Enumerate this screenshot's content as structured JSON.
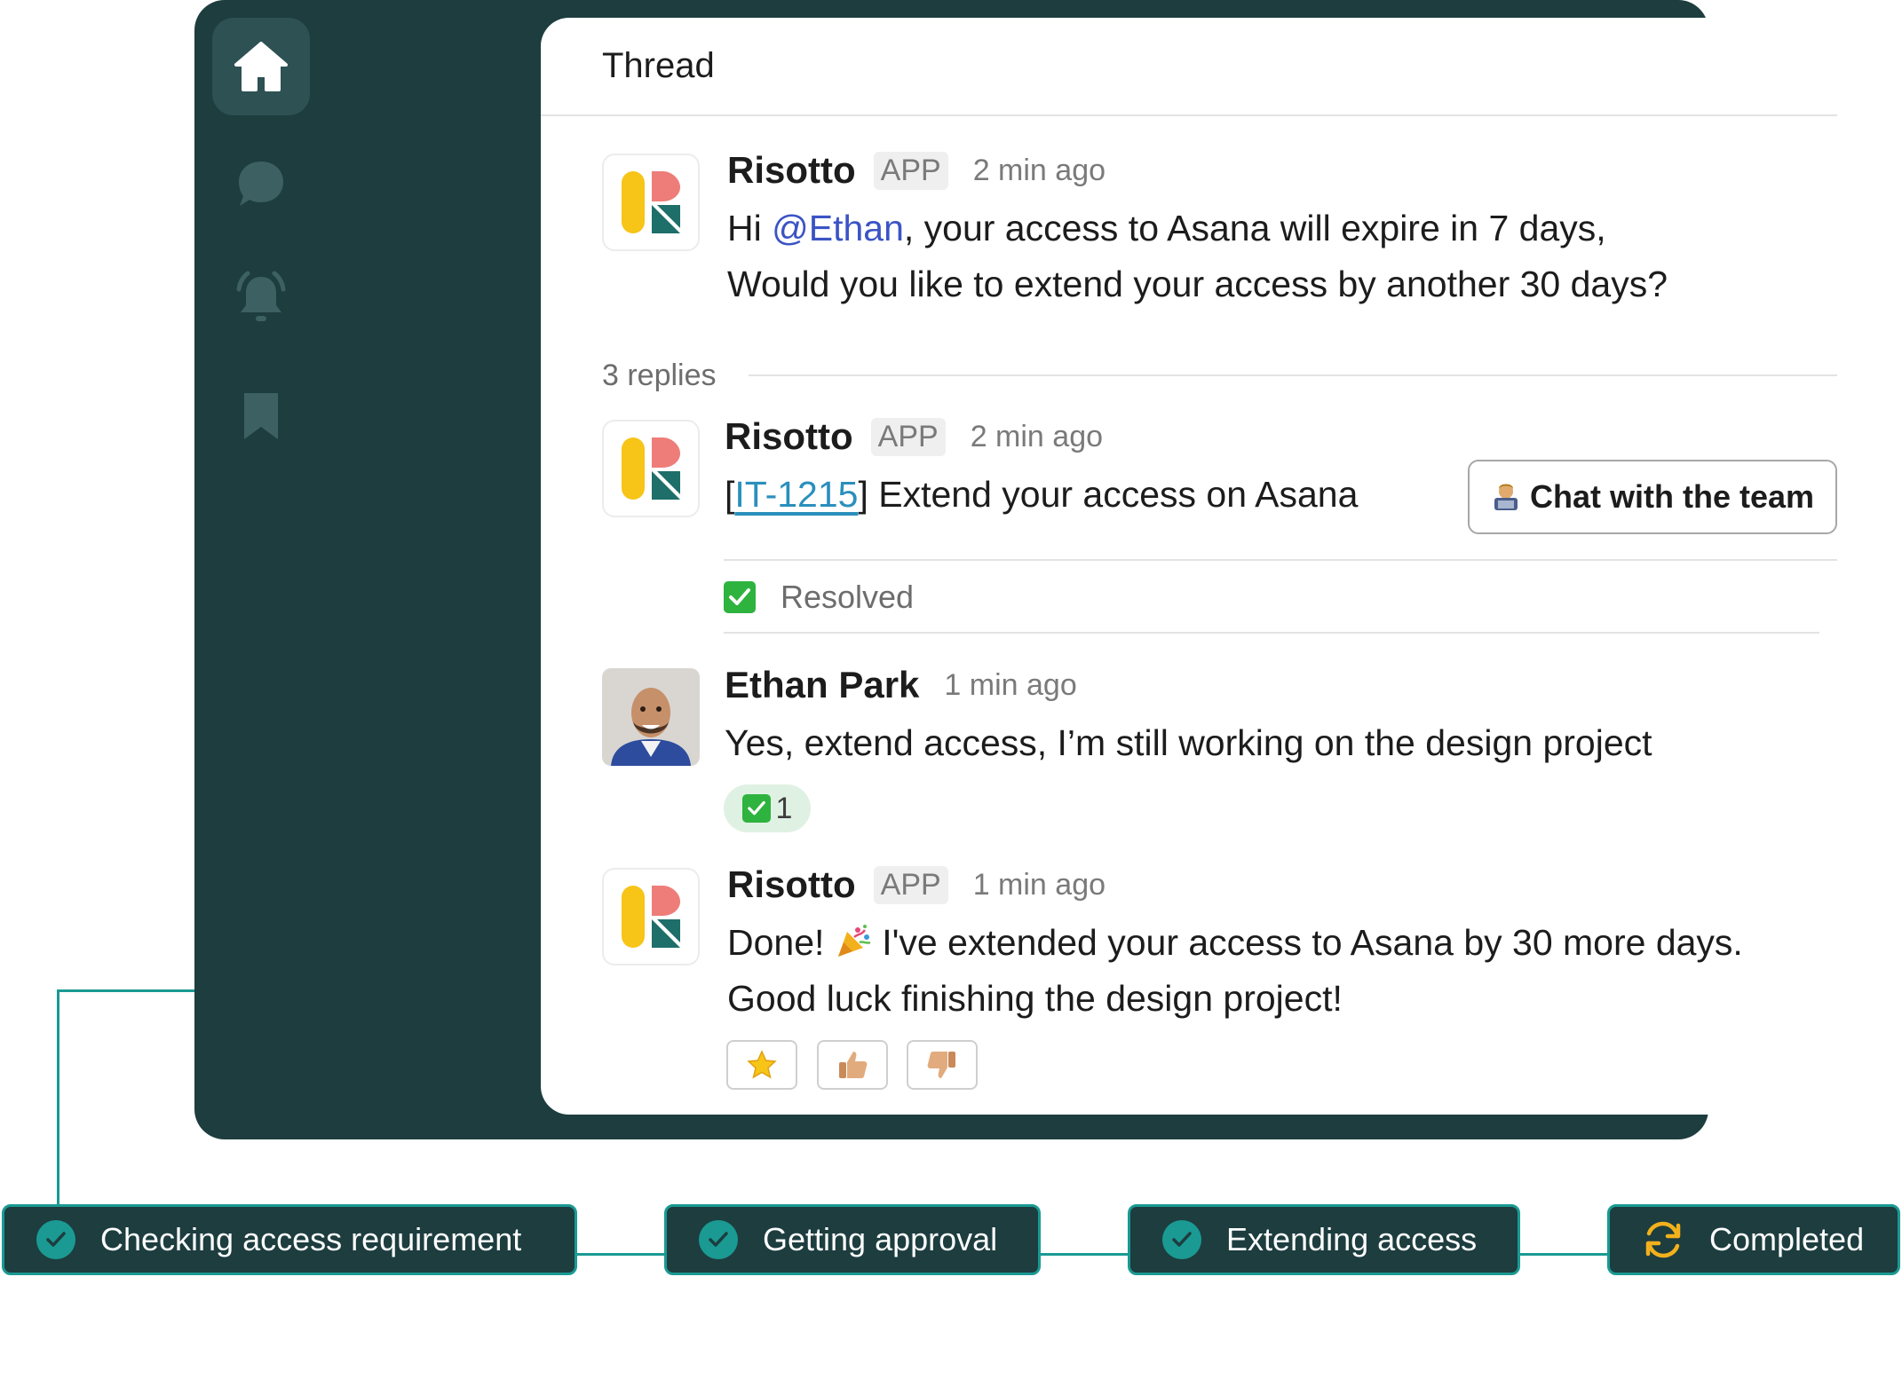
{
  "colors": {
    "frame": "#1d3d3f",
    "accent_teal": "#1a9a93",
    "mention": "#3b54c4",
    "link": "#2a8fbd",
    "resolved_green": "#2eb33f",
    "completed_orange": "#f2b11c"
  },
  "sidebar": {
    "items": [
      {
        "icon": "home-icon",
        "active": true
      },
      {
        "icon": "chat-bubble-icon",
        "active": false
      },
      {
        "icon": "bell-alert-icon",
        "active": false
      },
      {
        "icon": "bookmark-icon",
        "active": false
      }
    ]
  },
  "thread": {
    "title": "Thread",
    "replies_label": "3 replies",
    "messages": [
      {
        "author": "Risotto",
        "tag": "APP",
        "time": "2 min ago",
        "line1_prefix": "Hi ",
        "mention": "@Ethan",
        "line1_suffix": ", your access to Asana will expire in 7 days,",
        "line2": "Would you like to extend your access by another 30 days?"
      },
      {
        "author": "Risotto",
        "tag": "APP",
        "time": "2 min ago",
        "open_bracket": "[",
        "ticket": "IT-1215",
        "text_after": "] Extend your access on Asana",
        "button_label": "Chat with the team",
        "status": "Resolved"
      },
      {
        "author": "Ethan Park",
        "time": "1 min ago",
        "text": "Yes, extend access, I’m still working on the design project",
        "reaction_count": "1"
      },
      {
        "author": "Risotto",
        "tag": "APP",
        "time": "1 min ago",
        "line1_prefix": "Done! ",
        "line1_suffix": " I've extended your access to Asana by 30 more days.",
        "line2": "Good luck finishing the design project!",
        "reactions": [
          "star-icon",
          "thumbs-up-icon",
          "thumbs-down-icon"
        ]
      }
    ]
  },
  "steps": [
    {
      "label": "Checking access requirement",
      "state": "done"
    },
    {
      "label": "Getting approval",
      "state": "done"
    },
    {
      "label": "Extending access",
      "state": "done"
    },
    {
      "label": "Completed",
      "state": "in-progress"
    }
  ]
}
